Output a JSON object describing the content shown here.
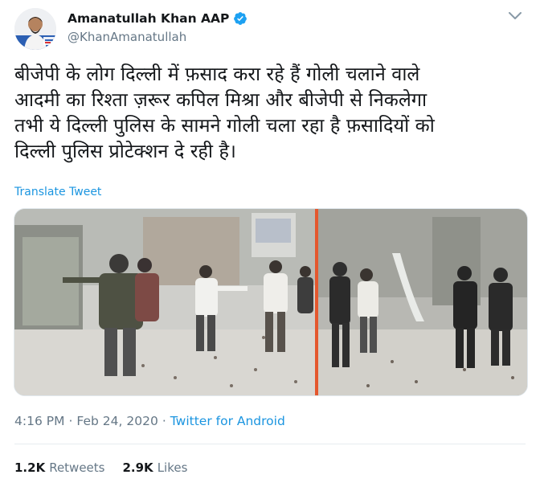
{
  "author": {
    "display_name": "Amanatullah Khan AAP",
    "handle": "@KhanAmanatullah",
    "verified": true,
    "avatar_icon": "profile-photo"
  },
  "tweet": {
    "text_lines": [
      "बीजेपी के लोग दिल्ली में फ़साद करा रहे हैं  गोली चलाने वाले",
      "आदमी का रिश्ता ज़रूर कपिल मिश्रा और बीजेपी से निकलेगा",
      "तभी ये दिल्ली पुलिस के सामने गोली चला रहा है फ़सादियों को",
      "दिल्ली पुलिस प्रोटेक्शन दे रही है।"
    ],
    "translate_label": "Translate Tweet"
  },
  "meta": {
    "time": "4:16 PM",
    "separator": "·",
    "date": "Feb 24, 2020",
    "source": "Twitter for Android"
  },
  "stats": {
    "retweets_count": "1.2K",
    "retweets_label": "Retweets",
    "likes_count": "2.9K",
    "likes_label": "Likes"
  },
  "colors": {
    "link": "#1b95e0",
    "secondary_text": "#657786",
    "primary_text": "#14171a",
    "divider": "#e6ecf0",
    "verified": "#1da1f2"
  }
}
